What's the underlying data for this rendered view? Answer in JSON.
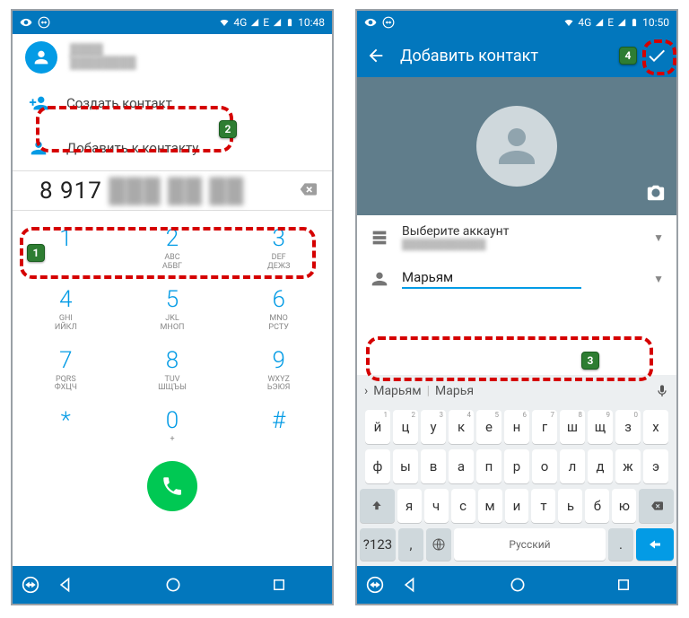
{
  "left": {
    "status_time": "10:48",
    "status_net": "4G",
    "suggest_name": "████",
    "suggest_sub": "████████",
    "create_contact": "Создать контакт",
    "add_to_contact": "Добавить к контакту",
    "number_visible": "8 917",
    "dialpad": [
      {
        "d": "1",
        "la": "",
        "lb": ""
      },
      {
        "d": "2",
        "la": "ABC",
        "lb": "АБВГ"
      },
      {
        "d": "3",
        "la": "DEF",
        "lb": "ДЕЖЗ"
      },
      {
        "d": "4",
        "la": "GHI",
        "lb": "ИЙКЛ"
      },
      {
        "d": "5",
        "la": "JKL",
        "lb": "МНОП"
      },
      {
        "d": "6",
        "la": "MNO",
        "lb": "РСТУ"
      },
      {
        "d": "7",
        "la": "PQRS",
        "lb": "ФХЦЧ"
      },
      {
        "d": "8",
        "la": "TUV",
        "lb": "ШЩЪЫ"
      },
      {
        "d": "9",
        "la": "WXYZ",
        "lb": "ЬЭЮЯ"
      },
      {
        "d": "*",
        "la": "",
        "lb": ""
      },
      {
        "d": "0",
        "la": "+",
        "lb": ""
      },
      {
        "d": "#",
        "la": "",
        "lb": ""
      }
    ]
  },
  "right": {
    "status_time": "10:50",
    "status_net": "4G",
    "title": "Добавить контакт",
    "account_label": "Выберите аккаунт",
    "account_sub": "████████████",
    "name_value": "Марьям",
    "kbd_sugg1": "Марьям",
    "kbd_sugg2": "Марья",
    "kbd_lang": "Русский",
    "kbd_numsym": "?123",
    "rows": {
      "r1": [
        "й",
        "ц",
        "у",
        "к",
        "е",
        "н",
        "г",
        "ш",
        "щ",
        "з",
        "х"
      ],
      "r2": [
        "ф",
        "ы",
        "в",
        "а",
        "п",
        "р",
        "о",
        "л",
        "д",
        "ж",
        "э"
      ],
      "r3": [
        "я",
        "ч",
        "с",
        "м",
        "и",
        "т",
        "ь",
        "б",
        "ю"
      ]
    }
  },
  "E_signal": "E"
}
